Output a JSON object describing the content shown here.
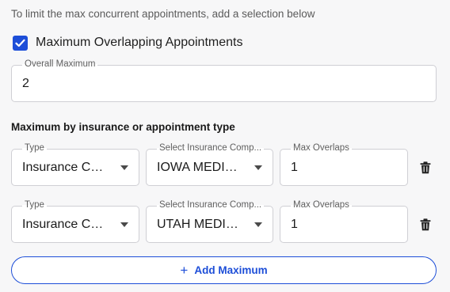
{
  "hint_text": "To limit the max concurrent appointments, add a selection below",
  "max_overlap_checkbox": {
    "label": "Maximum Overlapping Appointments",
    "checked": true
  },
  "overall_maximum": {
    "label": "Overall Maximum",
    "value": "2"
  },
  "section_title": "Maximum by insurance or appointment type",
  "rows": [
    {
      "type_label": "Type",
      "type_value": "Insurance Co...",
      "company_label": "Select Insurance Comp...",
      "company_value": "IOWA MEDIC...",
      "overlaps_label": "Max Overlaps",
      "overlaps_value": "1",
      "delete_icon": "trash-icon"
    },
    {
      "type_label": "Type",
      "type_value": "Insurance Co...",
      "company_label": "Select Insurance Comp...",
      "company_value": "UTAH MEDICA...",
      "overlaps_label": "Max Overlaps",
      "overlaps_value": "1",
      "delete_icon": "trash-icon"
    }
  ],
  "add_button": {
    "icon": "plus-icon",
    "label": "Add Maximum"
  },
  "colors": {
    "accent": "#1d4ed8",
    "background": "#f7f7f8",
    "border": "#cfcfd4"
  }
}
